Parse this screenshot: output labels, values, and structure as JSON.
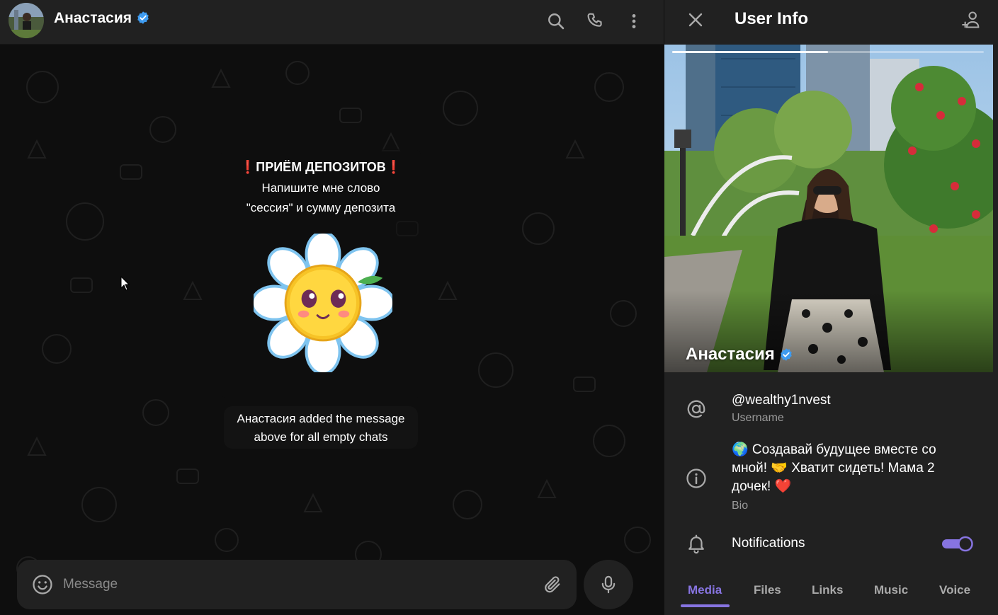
{
  "colors": {
    "accent": "#8774e1",
    "verified": "#3e9bf0",
    "header_bg": "#212121",
    "chat_bg": "#0e0e0e",
    "exclamation": "#e53935"
  },
  "chat": {
    "title": "Анастасия",
    "header_icons": [
      "search-icon",
      "phone-icon",
      "more-vertical-icon"
    ],
    "pinned_message": {
      "title_mark": "❗",
      "title": "ПРИЁМ ДЕПОЗИТОВ",
      "line1": "Напишите мне слово",
      "line2": "\"сессия\" и сумму депозита"
    },
    "service_message": {
      "line1": "Анастасия added the message",
      "line2": "above for all empty chats"
    },
    "composer": {
      "placeholder": "Message"
    }
  },
  "info": {
    "title": "User Info",
    "profile_name": "Анастасия",
    "username": "@wealthy1nvest",
    "username_label": "Username",
    "bio_line1": "🌍 Создавай будущее вместе со",
    "bio_line2": "мной! 🤝 Хватит сидеть! Мама 2",
    "bio_line3": "дочек! ❤️",
    "bio_label": "Bio",
    "notifications_label": "Notifications",
    "notifications_enabled": true,
    "photo_progress": 0.5,
    "tabs": [
      "Media",
      "Files",
      "Links",
      "Music",
      "Voice"
    ],
    "active_tab": "Media"
  }
}
